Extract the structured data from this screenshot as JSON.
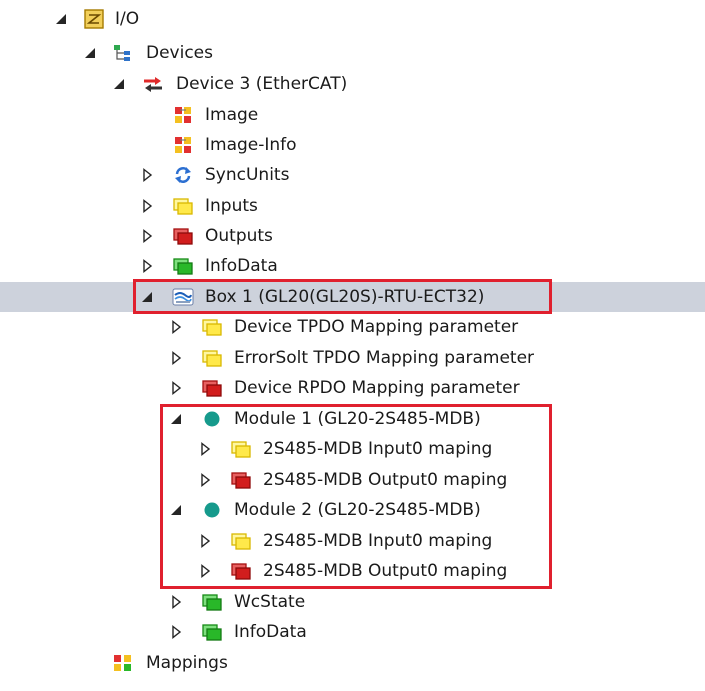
{
  "colors": {
    "selection": "#cdd2dc",
    "highlight": "#e0202e"
  },
  "tree": {
    "io": {
      "label": "I/O",
      "icon": "io-icon"
    },
    "devices": {
      "label": "Devices",
      "icon": "devices-icon"
    },
    "device3": {
      "label": "Device 3 (EtherCAT)",
      "icon": "ethercat-device-icon"
    },
    "image": {
      "label": "Image",
      "icon": "image-icon"
    },
    "image_info": {
      "label": "Image-Info",
      "icon": "image-info-icon"
    },
    "syncunits": {
      "label": "SyncUnits",
      "icon": "syncunits-icon"
    },
    "inputs": {
      "label": "Inputs",
      "icon": "inputs-icon"
    },
    "outputs": {
      "label": "Outputs",
      "icon": "outputs-icon"
    },
    "infodata": {
      "label": "InfoData",
      "icon": "infodata-icon"
    },
    "box1": {
      "label": "Box 1 (GL20(GL20S)-RTU-ECT32)",
      "icon": "box-icon"
    },
    "device_tpdo": {
      "label": "Device TPDO Mapping parameter",
      "icon": "input-folder-icon"
    },
    "errorsolt_tpdo": {
      "label": "ErrorSolt TPDO Mapping parameter",
      "icon": "input-folder-icon"
    },
    "device_rpdo": {
      "label": "Device RPDO Mapping parameter",
      "icon": "output-folder-icon"
    },
    "module1": {
      "label": "Module 1 (GL20-2S485-MDB)",
      "icon": "module-icon"
    },
    "m1_input": {
      "label": "2S485-MDB Input0 maping",
      "icon": "input-folder-icon"
    },
    "m1_output": {
      "label": "2S485-MDB Output0 maping",
      "icon": "output-folder-icon"
    },
    "module2": {
      "label": "Module 2 (GL20-2S485-MDB)",
      "icon": "module-icon"
    },
    "m2_input": {
      "label": "2S485-MDB Input0 maping",
      "icon": "input-folder-icon"
    },
    "m2_output": {
      "label": "2S485-MDB Output0 maping",
      "icon": "output-folder-icon"
    },
    "wcstate": {
      "label": "WcState",
      "icon": "wcstate-icon"
    },
    "infodata2": {
      "label": "InfoData",
      "icon": "infodata-icon"
    },
    "mappings": {
      "label": "Mappings",
      "icon": "mappings-icon"
    }
  }
}
